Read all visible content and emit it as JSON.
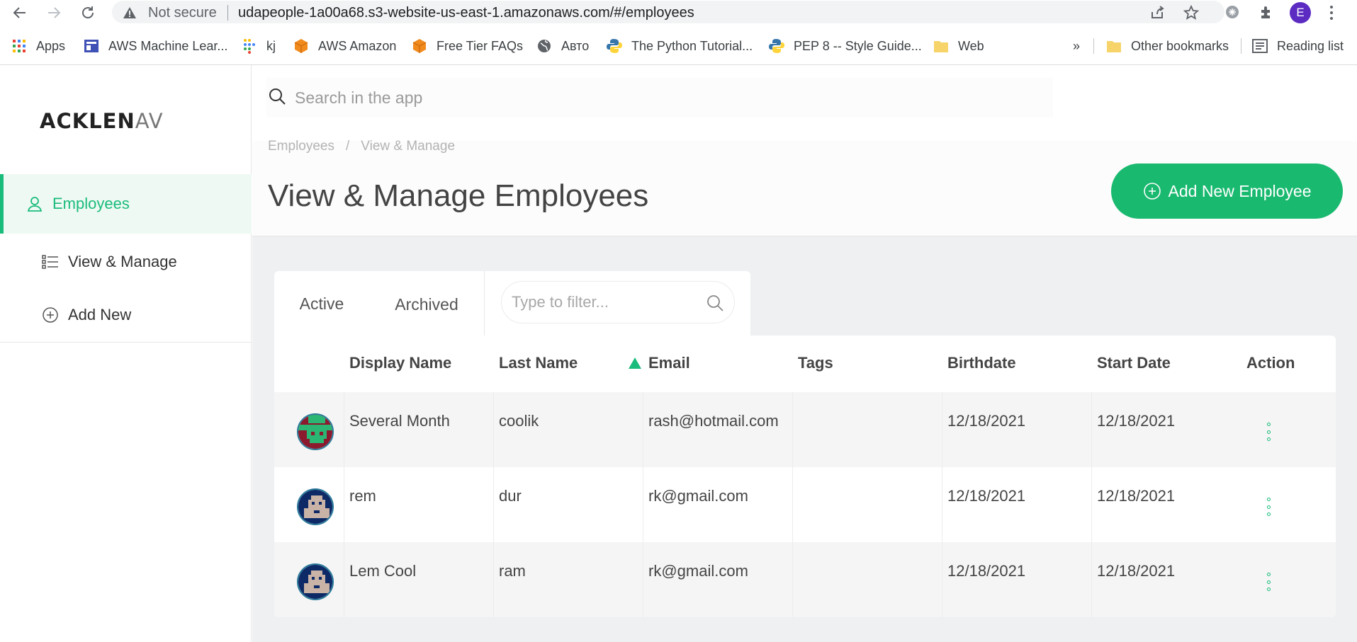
{
  "browser": {
    "not_secure": "Not secure",
    "url": "udapeople-1a00a68.s3-website-us-east-1.amazonaws.com/#/employees",
    "profile_initial": "E",
    "bookmarks": [
      {
        "label": "Apps"
      },
      {
        "label": "AWS Machine Lear..."
      },
      {
        "label": "kj"
      },
      {
        "label": "AWS Amazon"
      },
      {
        "label": "Free Tier FAQs"
      },
      {
        "label": "Авто"
      },
      {
        "label": "The Python Tutorial..."
      },
      {
        "label": "PEP 8 -- Style Guide..."
      },
      {
        "label": "Web"
      }
    ],
    "overflow": "»",
    "other_bookmarks": "Other bookmarks",
    "reading_list": "Reading list"
  },
  "app": {
    "logo": {
      "main": "ACKLEN",
      "fade": "AV"
    },
    "sidebar": {
      "items": [
        {
          "label": "Employees",
          "icon": "user-icon",
          "active": true
        },
        {
          "label": "View & Manage",
          "icon": "list-icon"
        },
        {
          "label": "Add New",
          "icon": "plus-circle-icon"
        }
      ]
    },
    "search": {
      "placeholder": "Search in the app"
    },
    "breadcrumb": [
      "Employees",
      "/",
      "View & Manage"
    ],
    "title": "View & Manage Employees",
    "add_button": "Add New Employee",
    "tabs": [
      {
        "label": "Active",
        "active": true
      },
      {
        "label": "Archived"
      }
    ],
    "filter": {
      "placeholder": "Type to filter..."
    },
    "accent": "#1abc7b",
    "table": {
      "columns": [
        "Display Name",
        "Last Name",
        "Email",
        "Tags",
        "Birthdate",
        "Start Date",
        "Action"
      ],
      "rows": [
        {
          "display_name": "Several Month",
          "last_name": "coolik",
          "email": "rash@hotmail.com",
          "tags": "",
          "birthdate": "12/18/2021",
          "start_date": "12/18/2021"
        },
        {
          "display_name": "rem",
          "last_name": "dur",
          "email": "rk@gmail.com",
          "tags": "",
          "birthdate": "12/18/2021",
          "start_date": "12/18/2021"
        },
        {
          "display_name": "Lem Cool",
          "last_name": "ram",
          "email": "rk@gmail.com",
          "tags": "",
          "birthdate": "12/18/2021",
          "start_date": "12/18/2021"
        }
      ]
    }
  }
}
